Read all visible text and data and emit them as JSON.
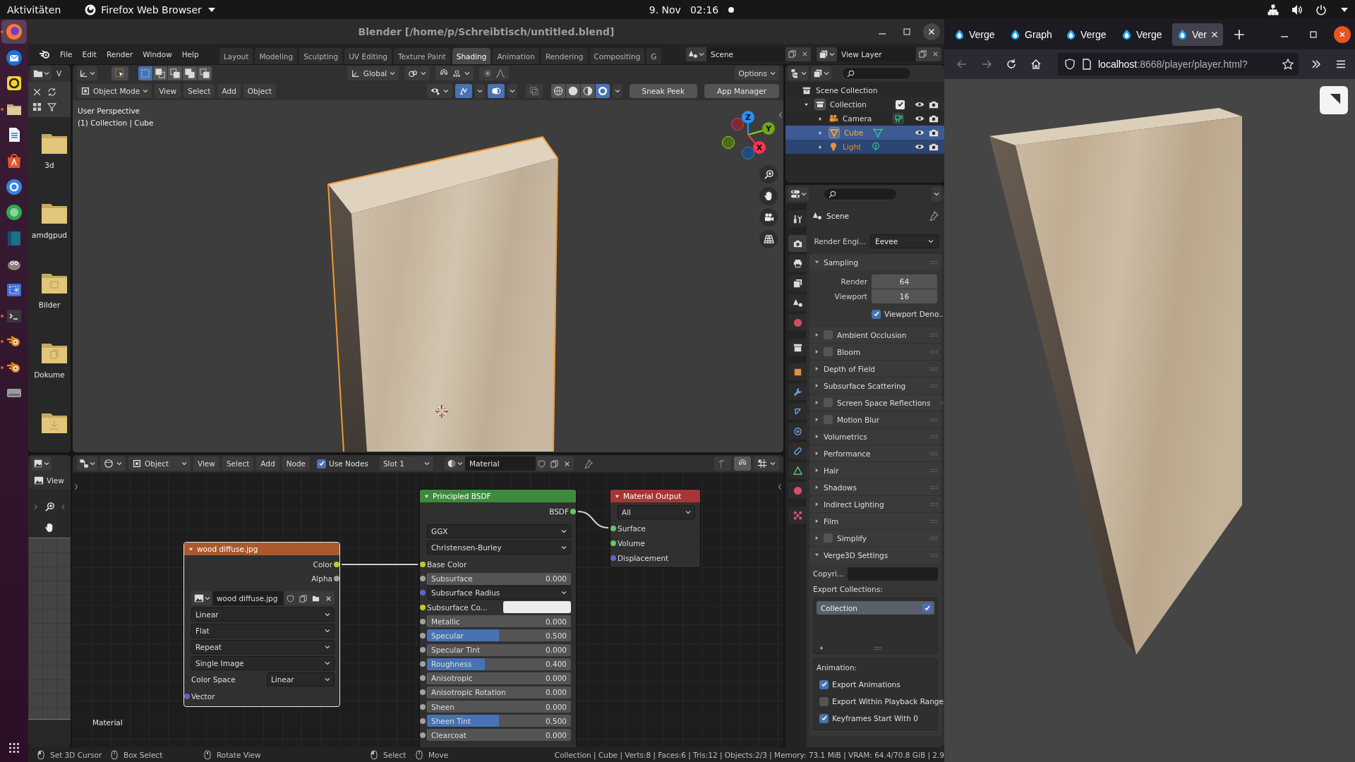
{
  "topbar": {
    "activities": "Aktivitäten",
    "app_menu": "Firefox Web Browser",
    "date": "9. Nov",
    "time": "02:16"
  },
  "dock": {
    "apps": [
      {
        "selected": true,
        "running": true
      },
      {
        "selected": false,
        "running": false
      },
      {
        "selected": false,
        "running": false
      },
      {
        "selected": false,
        "running": true
      },
      {
        "selected": false,
        "running": false
      },
      {
        "selected": false,
        "running": false
      },
      {
        "selected": false,
        "running": false
      },
      {
        "selected": false,
        "running": false
      },
      {
        "selected": false,
        "running": false
      },
      {
        "selected": false,
        "running": false
      },
      {
        "selected": false,
        "running": false
      },
      {
        "selected": false,
        "running": true
      },
      {
        "selected": false,
        "running": true
      },
      {
        "selected": false,
        "running": true
      },
      {
        "selected": false,
        "running": false
      }
    ]
  },
  "blender": {
    "title": "Blender [/home/p/Schreibtisch/untitled.blend]",
    "menu": [
      "File",
      "Edit",
      "Render",
      "Window",
      "Help"
    ],
    "workspaces": [
      {
        "label": "Layout",
        "selected": false
      },
      {
        "label": "Modeling",
        "selected": false
      },
      {
        "label": "Sculpting",
        "selected": false
      },
      {
        "label": "UV Editing",
        "selected": false
      },
      {
        "label": "Texture Paint",
        "selected": false
      },
      {
        "label": "Shading",
        "selected": true
      },
      {
        "label": "Animation",
        "selected": false
      },
      {
        "label": "Rendering",
        "selected": false
      },
      {
        "label": "Compositing",
        "selected": false
      },
      {
        "label": "G",
        "selected": false
      }
    ],
    "scene": "Scene",
    "view_layer": "View Layer",
    "file_browser": {
      "menu": "V",
      "folders": [
        "3d",
        "amdgpud",
        "Bilder",
        "Dokume"
      ]
    },
    "viewport": {
      "select_modes": [
        {
          "selected": true
        },
        {
          "selected": false
        },
        {
          "selected": false
        },
        {
          "selected": false
        },
        {
          "selected": false
        }
      ],
      "orientation": "Global",
      "options": "Options",
      "mode": "Object Mode",
      "menu": [
        "View",
        "Select",
        "Add",
        "Object"
      ],
      "gizmos": {
        "on": true
      },
      "overlays": {
        "on": true
      },
      "xray": {
        "on": false
      },
      "shading": [
        {
          "selected": false
        },
        {
          "selected": false
        },
        {
          "selected": false
        },
        {
          "selected": true
        }
      ],
      "buttons": [
        "Sneak Peek",
        "App Manager"
      ],
      "info": [
        "User Perspective",
        "(1) Collection | Cube"
      ],
      "axes": [
        "X",
        "Y",
        "Z"
      ]
    },
    "outliner": {
      "tree": [
        {
          "label": "Scene Collection",
          "children": [
            {
              "label": "Collection",
              "expanded": true,
              "checked": true,
              "children": [
                {
                  "label": "Camera",
                  "kind": "camera",
                  "selected": false,
                  "active": false,
                  "expanded": false
                },
                {
                  "label": "Cube",
                  "kind": "mesh",
                  "selected": true,
                  "active": true,
                  "expanded": false
                },
                {
                  "label": "Light",
                  "kind": "light",
                  "selected": true,
                  "active": false,
                  "expanded": false
                }
              ]
            }
          ]
        }
      ]
    },
    "properties": {
      "tabs": [
        {
          "selected": false
        },
        {
          "selected": true
        },
        {
          "selected": false
        },
        {
          "selected": false
        },
        {
          "selected": false
        },
        {
          "selected": false
        },
        {
          "selected": false
        },
        {
          "selected": false
        },
        {
          "selected": false
        },
        {
          "selected": false
        },
        {
          "selected": false
        },
        {
          "selected": false
        },
        {
          "selected": false
        },
        {
          "selected": false
        },
        {
          "selected": false
        }
      ],
      "context": "Scene",
      "engine_label": "Render Engi...",
      "engine": "Eevee",
      "panels": [
        {
          "label": "Sampling",
          "expanded": true,
          "fields": [
            {
              "label": "Render",
              "value": "64"
            },
            {
              "label": "Viewport",
              "value": "16"
            }
          ],
          "checks": [
            {
              "label": "Viewport Deno...",
              "checked": true
            }
          ]
        },
        {
          "label": "Ambient Occlusion",
          "expanded": false,
          "checked": false
        },
        {
          "label": "Bloom",
          "expanded": false,
          "checked": false
        },
        {
          "label": "Depth of Field",
          "expanded": false
        },
        {
          "label": "Subsurface Scattering",
          "expanded": false
        },
        {
          "label": "Screen Space Reflections",
          "expanded": false,
          "checked": false
        },
        {
          "label": "Motion Blur",
          "expanded": false,
          "checked": false
        },
        {
          "label": "Volumetrics",
          "expanded": false
        },
        {
          "label": "Performance",
          "expanded": false
        },
        {
          "label": "Hair",
          "expanded": false
        },
        {
          "label": "Shadows",
          "expanded": false
        },
        {
          "label": "Indirect Lighting",
          "expanded": false
        },
        {
          "label": "Film",
          "expanded": false
        },
        {
          "label": "Simplify",
          "expanded": false,
          "checked": false
        },
        {
          "label": "Verge3D Settings",
          "expanded": true,
          "copyright_label": "Copyri...",
          "collections_label": "Export Collections:",
          "collections": [
            {
              "label": "Collection",
              "selected": true,
              "checked": true
            }
          ],
          "animation": {
            "label": "Animation:",
            "checks": [
              {
                "label": "Export Animations",
                "checked": true
              },
              {
                "label": "Export Within Playback Range",
                "checked": false
              },
              {
                "label": "Keyframes Start With 0",
                "checked": true
              }
            ]
          }
        }
      ]
    },
    "node_editor": {
      "object": "Object",
      "menu": [
        "View",
        "Select",
        "Add",
        "Node"
      ],
      "use_nodes": {
        "label": "Use Nodes",
        "checked": true
      },
      "slot": "Slot 1",
      "material": "Material",
      "context": "Material",
      "nodes": [
        {
          "kind": "texture",
          "selected": true,
          "title": "wood diffuse.jpg",
          "outputs": [
            {
              "label": "Color",
              "socket": {
                "color": "#c7c729"
              }
            },
            {
              "label": "Alpha",
              "socket": {
                "color": "#a1a1a1"
              }
            }
          ],
          "image": "wood diffuse.jpg",
          "options": [
            "Linear",
            "Flat",
            "Repeat",
            "Single Image"
          ],
          "color_space": {
            "label": "Color Space",
            "value": "Linear"
          },
          "inputs": [
            {
              "label": "Vector",
              "socket": {
                "color": "#6363c7"
              },
              "kind": "label"
            }
          ]
        },
        {
          "kind": "shader",
          "selected": false,
          "title": "Principled BSDF",
          "outputs": [
            {
              "label": "BSDF",
              "socket": {
                "color": "#63c763"
              }
            }
          ],
          "options": [
            "GGX",
            "Christensen-Burley"
          ],
          "inputs": [
            {
              "label": "Base Color",
              "socket": {
                "color": "#c7c729"
              },
              "kind": "label"
            },
            {
              "label": "Subsurface",
              "socket": {
                "color": "#a1a1a1"
              },
              "kind": "value",
              "value": "0.000",
              "level": 0
            },
            {
              "label": "Subsurface Radius",
              "socket": {
                "color": "#6363c7"
              },
              "kind": "dropdown"
            },
            {
              "label": "Subsurface Co...",
              "socket": {
                "color": "#c7c729"
              },
              "kind": "swatch",
              "color": "#ececec"
            },
            {
              "label": "Metallic",
              "socket": {
                "color": "#a1a1a1"
              },
              "kind": "value",
              "value": "0.000",
              "level": 0
            },
            {
              "label": "Specular",
              "socket": {
                "color": "#a1a1a1"
              },
              "kind": "value",
              "value": "0.500",
              "level": 0.5
            },
            {
              "label": "Specular Tint",
              "socket": {
                "color": "#a1a1a1"
              },
              "kind": "value",
              "value": "0.000",
              "level": 0
            },
            {
              "label": "Roughness",
              "socket": {
                "color": "#a1a1a1"
              },
              "kind": "value",
              "value": "0.400",
              "level": 0.4
            },
            {
              "label": "Anisotropic",
              "socket": {
                "color": "#a1a1a1"
              },
              "kind": "value",
              "value": "0.000",
              "level": 0
            },
            {
              "label": "Anisotropic Rotation",
              "socket": {
                "color": "#a1a1a1"
              },
              "kind": "value",
              "value": "0.000",
              "level": 0
            },
            {
              "label": "Sheen",
              "socket": {
                "color": "#a1a1a1"
              },
              "kind": "value",
              "value": "0.000",
              "level": 0
            },
            {
              "label": "Sheen Tint",
              "socket": {
                "color": "#a1a1a1"
              },
              "kind": "value",
              "value": "0.500",
              "level": 0.5
            },
            {
              "label": "Clearcoat",
              "socket": {
                "color": "#a1a1a1"
              },
              "kind": "value",
              "value": "0.000",
              "level": 0
            }
          ]
        },
        {
          "kind": "output",
          "selected": false,
          "title": "Material Output",
          "target": "All",
          "inputs": [
            {
              "label": "Surface",
              "socket": {
                "color": "#63c763"
              },
              "kind": "label"
            },
            {
              "label": "Volume",
              "socket": {
                "color": "#63c763"
              },
              "kind": "label"
            },
            {
              "label": "Displacement",
              "socket": {
                "color": "#6363c7"
              },
              "kind": "label"
            }
          ]
        }
      ]
    },
    "image_editor": {
      "menu": "View"
    },
    "status_bar": {
      "hints": [
        "Set 3D Cursor",
        "Box Select",
        "Rotate View",
        "Select",
        "Move"
      ],
      "stats": "Collection | Cube | Verts:8 | Faces:6 | Tris:12 | Objects:2/3 | Memory: 73.1 MiB | VRAM: 64.4/70.8 GiB | 2.9"
    }
  },
  "firefox": {
    "tabs": [
      {
        "label": "Verge",
        "selected": false
      },
      {
        "label": "Graph",
        "selected": false
      },
      {
        "label": "Verge",
        "selected": false
      },
      {
        "label": "Verge",
        "selected": false
      },
      {
        "label": "Ver",
        "selected": true
      }
    ],
    "back": {
      "disabled": true
    },
    "forward": {
      "disabled": true
    },
    "url_host": "localhost",
    "url_path": ":8668/player/player.html?"
  }
}
